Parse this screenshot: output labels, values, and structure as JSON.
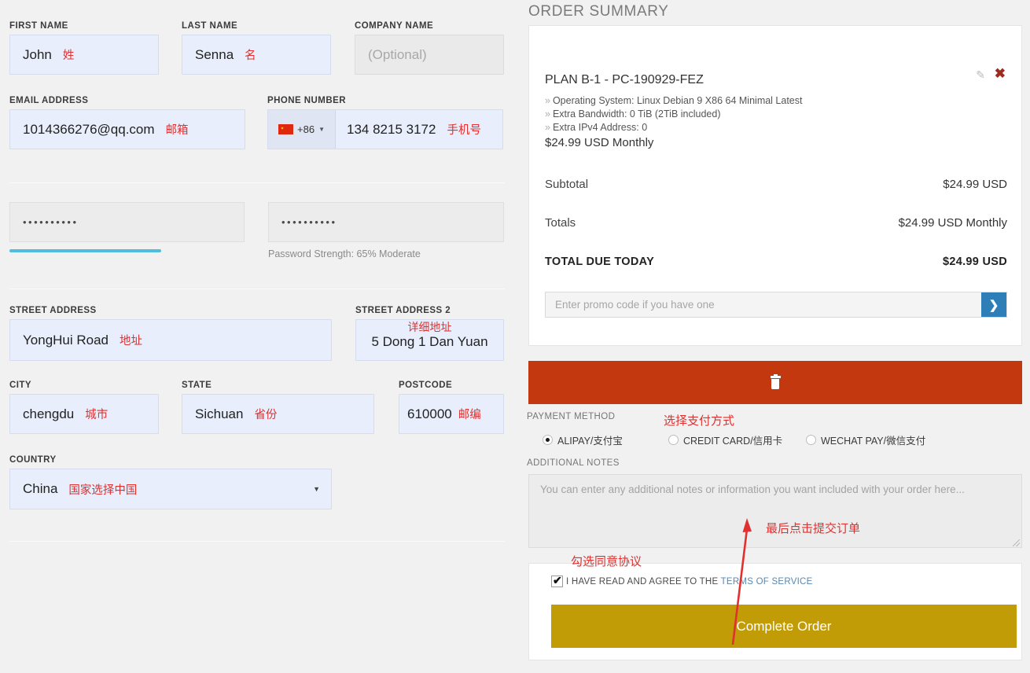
{
  "form": {
    "first_name": {
      "label": "FIRST NAME",
      "value": "John",
      "note": "姓"
    },
    "last_name": {
      "label": "LAST NAME",
      "value": "Senna",
      "note": "名"
    },
    "company": {
      "label": "COMPANY NAME",
      "placeholder": "(Optional)",
      "value": ""
    },
    "email": {
      "label": "EMAIL ADDRESS",
      "value": "1014366276@qq.com",
      "note": "邮箱"
    },
    "phone": {
      "label": "PHONE NUMBER",
      "dial_code": "+86",
      "value": "134 8215 3172",
      "note": "手机号",
      "flag": "cn-flag-icon"
    },
    "password": {
      "value": "••••••••••",
      "strength_percent": 65,
      "strength_text": "Password Strength: 65% Moderate"
    },
    "password_confirm": {
      "value": "••••••••••"
    },
    "street1": {
      "label": "STREET ADDRESS",
      "value": "YongHui Road",
      "note": "地址"
    },
    "street2": {
      "label": "STREET ADDRESS 2",
      "value": "5 Dong 1 Dan Yuan",
      "note": "详细地址"
    },
    "city": {
      "label": "CITY",
      "value": "chengdu",
      "note": "城市"
    },
    "state": {
      "label": "STATE",
      "value": "Sichuan",
      "note": "省份"
    },
    "postcode": {
      "label": "POSTCODE",
      "value": "610000",
      "note": "邮编"
    },
    "country": {
      "label": "COUNTRY",
      "value": "China",
      "note": "国家选择中国"
    }
  },
  "order_summary": {
    "title": "ORDER SUMMARY",
    "plan_id": "PLAN B-1 - PC-190929-FEZ",
    "features": [
      "Operating System: Linux Debian 9 X86 64 Minimal Latest",
      "Extra Bandwidth: 0 TiB (2TiB included)",
      "Extra IPv4 Address: 0"
    ],
    "plan_price": "$24.99 USD Monthly",
    "edit_icon": "pencil-icon",
    "remove_icon": "close-x-icon",
    "lines": [
      {
        "label": "Subtotal",
        "value": "$24.99 USD"
      },
      {
        "label": "Totals",
        "value": "$24.99 USD Monthly"
      },
      {
        "label": "TOTAL DUE TODAY",
        "value": "$24.99 USD",
        "bold": true
      }
    ],
    "promo": {
      "placeholder": "Enter promo code if you have one",
      "value": "",
      "submit_icon": "chevron-right-icon"
    },
    "delete_bar_icon": "trash-icon"
  },
  "payment": {
    "label": "PAYMENT METHOD",
    "note": "选择支付方式",
    "options": [
      {
        "label": "ALIPAY/支付宝",
        "selected": true
      },
      {
        "label": "CREDIT CARD/信用卡",
        "selected": false
      },
      {
        "label": "WECHAT PAY/微信支付",
        "selected": false
      }
    ]
  },
  "notes": {
    "label": "ADDITIONAL NOTES",
    "placeholder": "You can enter any additional notes or information you want included with your order here...",
    "value": ""
  },
  "terms": {
    "note": "勾选同意协议",
    "checked": true,
    "text": "I HAVE READ AND AGREE TO THE ",
    "link": "TERMS OF SERVICE"
  },
  "submit": {
    "label": "Complete Order",
    "note": "最后点击提交订单"
  },
  "colors": {
    "accent_blue": "#2e7fb8",
    "delete_red": "#c3380f",
    "submit_gold": "#c29c07",
    "annotation_red": "#e03030",
    "strength_bar": "#4fbddd",
    "filled_field": "#e8eefb"
  }
}
